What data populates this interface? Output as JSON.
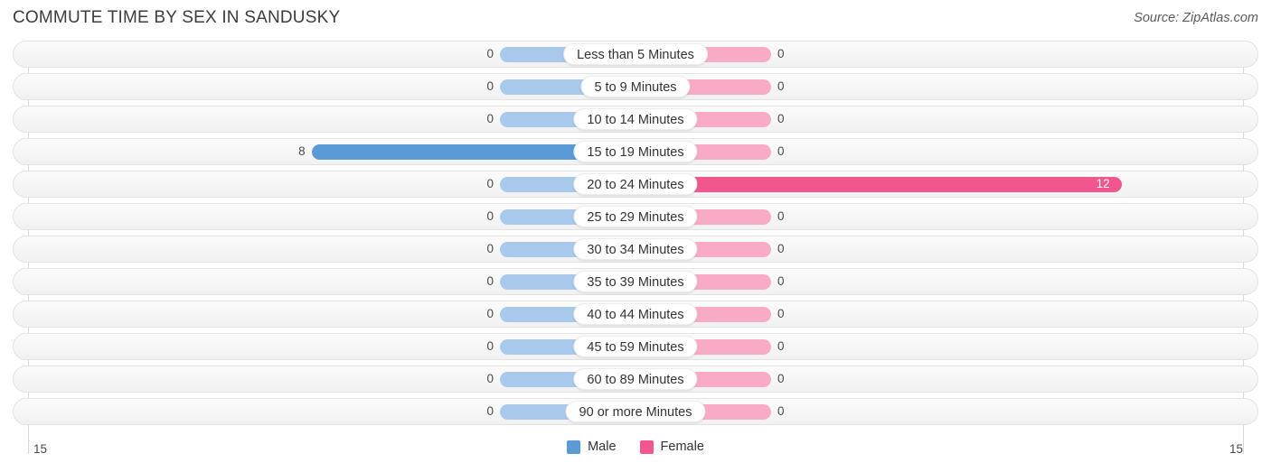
{
  "header": {
    "title": "COMMUTE TIME BY SEX IN SANDUSKY",
    "source": "Source: ZipAtlas.com"
  },
  "axis": {
    "min_label": "15",
    "max_label": "15"
  },
  "legend": {
    "items": [
      {
        "label": "Male",
        "color": "#5b9bd5"
      },
      {
        "label": "Female",
        "color": "#f2568f"
      }
    ]
  },
  "colors": {
    "male_filled": "#5b9bd5",
    "male_zero": "#a8c8ec",
    "female_filled": "#f2568f",
    "female_zero": "#f8aac6",
    "row_border": "#e2e2e2",
    "gridline": "#d8d8d8"
  },
  "chart_data": {
    "type": "bar",
    "title": "COMMUTE TIME BY SEX IN SANDUSKY",
    "subtitle": "",
    "xlabel": "",
    "ylabel": "",
    "orientation": "horizontal-diverging",
    "axis_max": 15,
    "xlim": [
      15,
      15
    ],
    "grid": true,
    "legend_position": "bottom-center",
    "categories": [
      "Less than 5 Minutes",
      "5 to 9 Minutes",
      "10 to 14 Minutes",
      "15 to 19 Minutes",
      "20 to 24 Minutes",
      "25 to 29 Minutes",
      "30 to 34 Minutes",
      "35 to 39 Minutes",
      "40 to 44 Minutes",
      "45 to 59 Minutes",
      "60 to 89 Minutes",
      "90 or more Minutes"
    ],
    "series": [
      {
        "name": "Male",
        "values": [
          0,
          0,
          0,
          8,
          0,
          0,
          0,
          0,
          0,
          0,
          0,
          0
        ],
        "labels": [
          "0",
          "0",
          "0",
          "8",
          "0",
          "0",
          "0",
          "0",
          "0",
          "0",
          "0",
          "0"
        ]
      },
      {
        "name": "Female",
        "values": [
          0,
          0,
          0,
          0,
          12,
          0,
          0,
          0,
          0,
          0,
          0,
          0
        ],
        "labels": [
          "0",
          "0",
          "0",
          "0",
          "12",
          "0",
          "0",
          "0",
          "0",
          "0",
          "0",
          "0"
        ]
      }
    ]
  }
}
